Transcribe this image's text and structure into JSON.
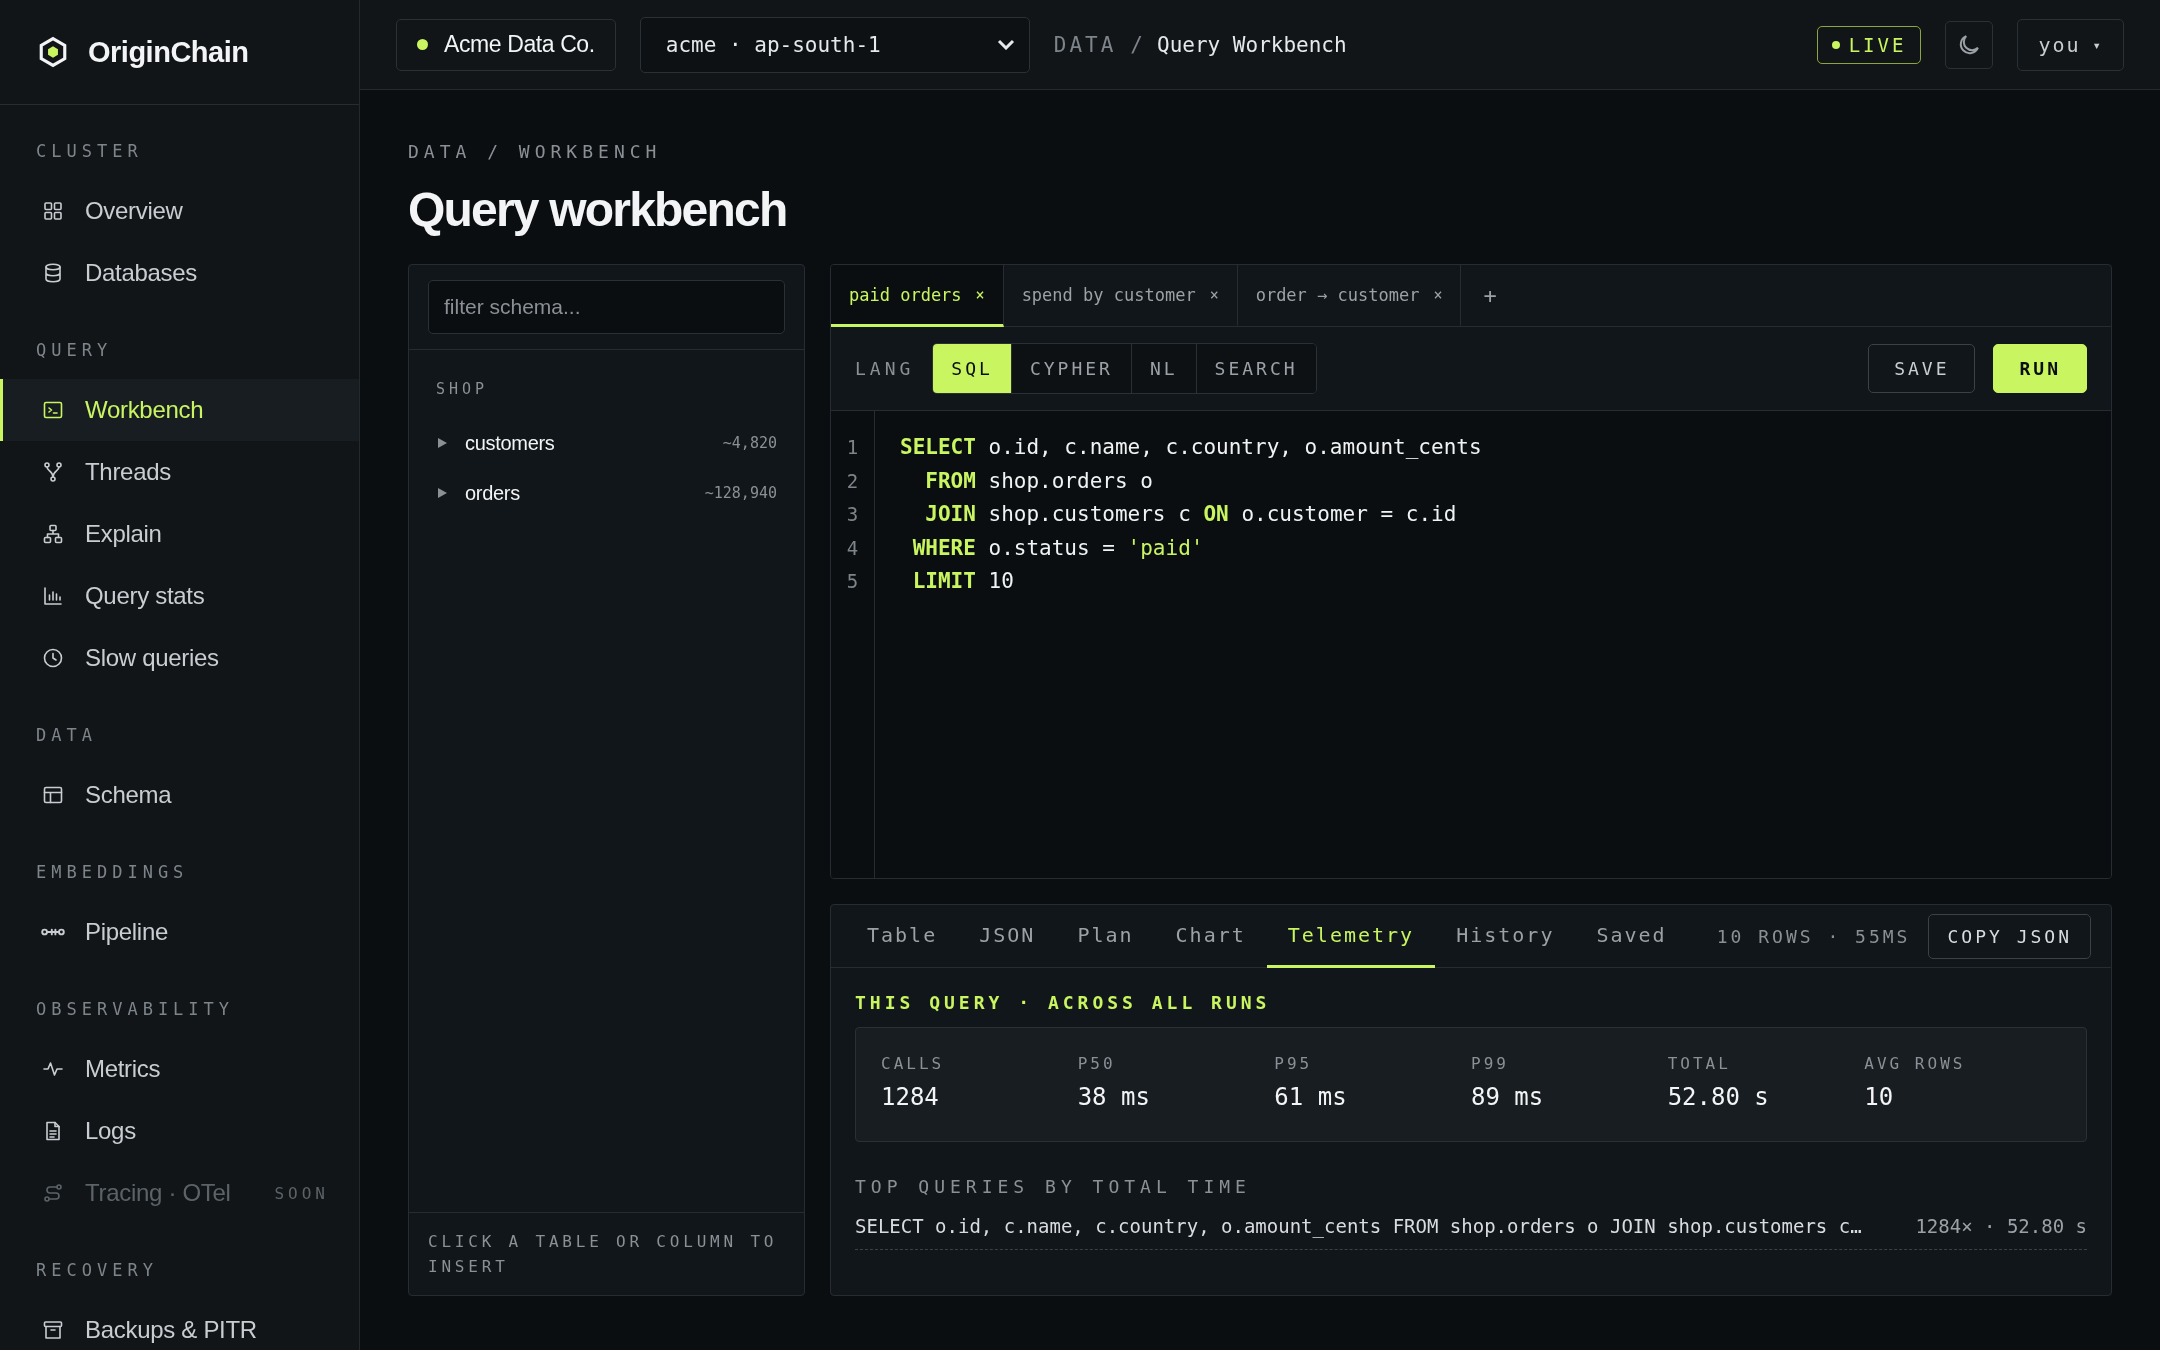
{
  "brand": {
    "name": "OriginChain"
  },
  "sidebar": {
    "sections": [
      {
        "label": "CLUSTER",
        "items": [
          {
            "label": "Overview",
            "selected": false,
            "disabled": false
          },
          {
            "label": "Databases",
            "selected": false,
            "disabled": false
          }
        ]
      },
      {
        "label": "QUERY",
        "items": [
          {
            "label": "Workbench",
            "selected": true,
            "disabled": false
          },
          {
            "label": "Threads",
            "selected": false,
            "disabled": false
          },
          {
            "label": "Explain",
            "selected": false,
            "disabled": false
          },
          {
            "label": "Query stats",
            "selected": false,
            "disabled": false
          },
          {
            "label": "Slow queries",
            "selected": false,
            "disabled": false
          }
        ]
      },
      {
        "label": "DATA",
        "items": [
          {
            "label": "Schema",
            "selected": false,
            "disabled": false
          }
        ]
      },
      {
        "label": "EMBEDDINGS",
        "items": [
          {
            "label": "Pipeline",
            "selected": false,
            "disabled": false
          }
        ]
      },
      {
        "label": "OBSERVABILITY",
        "items": [
          {
            "label": "Metrics",
            "selected": false,
            "disabled": false
          },
          {
            "label": "Logs",
            "selected": false,
            "disabled": false
          },
          {
            "label": "Tracing · OTel",
            "selected": false,
            "disabled": true,
            "badge": "SOON"
          }
        ]
      },
      {
        "label": "RECOVERY",
        "items": [
          {
            "label": "Backups & PITR",
            "selected": false,
            "disabled": false
          }
        ]
      }
    ]
  },
  "topbar": {
    "org": {
      "name": "Acme Data Co."
    },
    "cluster_select": {
      "value": "acme · ap-south-1"
    },
    "breadcrumb": {
      "section": "DATA",
      "separator": "/",
      "page": "Query Workbench"
    },
    "live_badge": "LIVE",
    "user": {
      "label": "you",
      "caret": "▾"
    }
  },
  "page": {
    "breadcrumb": "DATA / WORKBENCH",
    "title": "Query workbench"
  },
  "schema": {
    "placeholder": "filter schema...",
    "group": "SHOP",
    "tables": [
      {
        "name": "customers",
        "count": "~4,820",
        "expanded": false
      },
      {
        "name": "orders",
        "count": "~128,940",
        "expanded": false
      }
    ],
    "hint": "CLICK A TABLE OR COLUMN TO INSERT"
  },
  "editor": {
    "tabs": [
      {
        "label": "paid orders",
        "close": "×",
        "selected": true
      },
      {
        "label": "spend by customer",
        "close": "×",
        "selected": false
      },
      {
        "label": "order → customer",
        "close": "×",
        "selected": false
      }
    ],
    "add_tab": "+",
    "lang_label": "LANG",
    "langs": [
      {
        "label": "SQL",
        "selected": true
      },
      {
        "label": "CYPHER",
        "selected": false
      },
      {
        "label": "NL",
        "selected": false
      },
      {
        "label": "SEARCH",
        "selected": false
      }
    ],
    "buttons": [
      {
        "label": "SAVE",
        "kind": "secondary"
      },
      {
        "label": "RUN",
        "kind": "primary"
      }
    ],
    "lines": [
      {
        "number": "1",
        "tokens": [
          {
            "text": "SELECT",
            "kind": "keyword"
          },
          {
            "text": " o.id, c.name, c.country, o.amount_cents",
            "kind": "plain"
          }
        ]
      },
      {
        "number": "2",
        "tokens": [
          {
            "text": "  FROM",
            "kind": "keyword"
          },
          {
            "text": " shop.orders o",
            "kind": "plain"
          }
        ]
      },
      {
        "number": "3",
        "tokens": [
          {
            "text": "  JOIN",
            "kind": "keyword"
          },
          {
            "text": " shop.customers c ",
            "kind": "plain"
          },
          {
            "text": "ON",
            "kind": "keyword"
          },
          {
            "text": " o.customer = c.id",
            "kind": "plain"
          }
        ]
      },
      {
        "number": "4",
        "tokens": [
          {
            "text": " WHERE",
            "kind": "keyword"
          },
          {
            "text": " o.status = ",
            "kind": "plain"
          },
          {
            "text": "'paid'",
            "kind": "string"
          }
        ]
      },
      {
        "number": "5",
        "tokens": [
          {
            "text": " LIMIT",
            "kind": "keyword"
          },
          {
            "text": " 10",
            "kind": "plain"
          }
        ]
      }
    ]
  },
  "results": {
    "tabs": [
      {
        "label": "Table",
        "selected": false
      },
      {
        "label": "JSON",
        "selected": false
      },
      {
        "label": "Plan",
        "selected": false
      },
      {
        "label": "Chart",
        "selected": false
      },
      {
        "label": "Telemetry",
        "selected": true
      },
      {
        "label": "History",
        "selected": false
      },
      {
        "label": "Saved",
        "selected": false
      }
    ],
    "summary": "10 ROWS · 55MS",
    "copy_button": "COPY JSON",
    "section_title": "THIS QUERY · ACROSS ALL RUNS",
    "stats": [
      {
        "label": "CALLS",
        "value": "1284"
      },
      {
        "label": "P50",
        "value": "38 ms"
      },
      {
        "label": "P95",
        "value": "61 ms"
      },
      {
        "label": "P99",
        "value": "89 ms"
      },
      {
        "label": "TOTAL",
        "value": "52.80 s"
      },
      {
        "label": "AVG ROWS",
        "value": "10"
      }
    ],
    "top_title": "TOP QUERIES BY TOTAL TIME",
    "top_queries": [
      {
        "query": "SELECT o.id, c.name, c.country, o.amount_cents FROM shop.orders o JOIN shop.customers c…",
        "stats": "1284× · 52.80 s"
      }
    ]
  }
}
